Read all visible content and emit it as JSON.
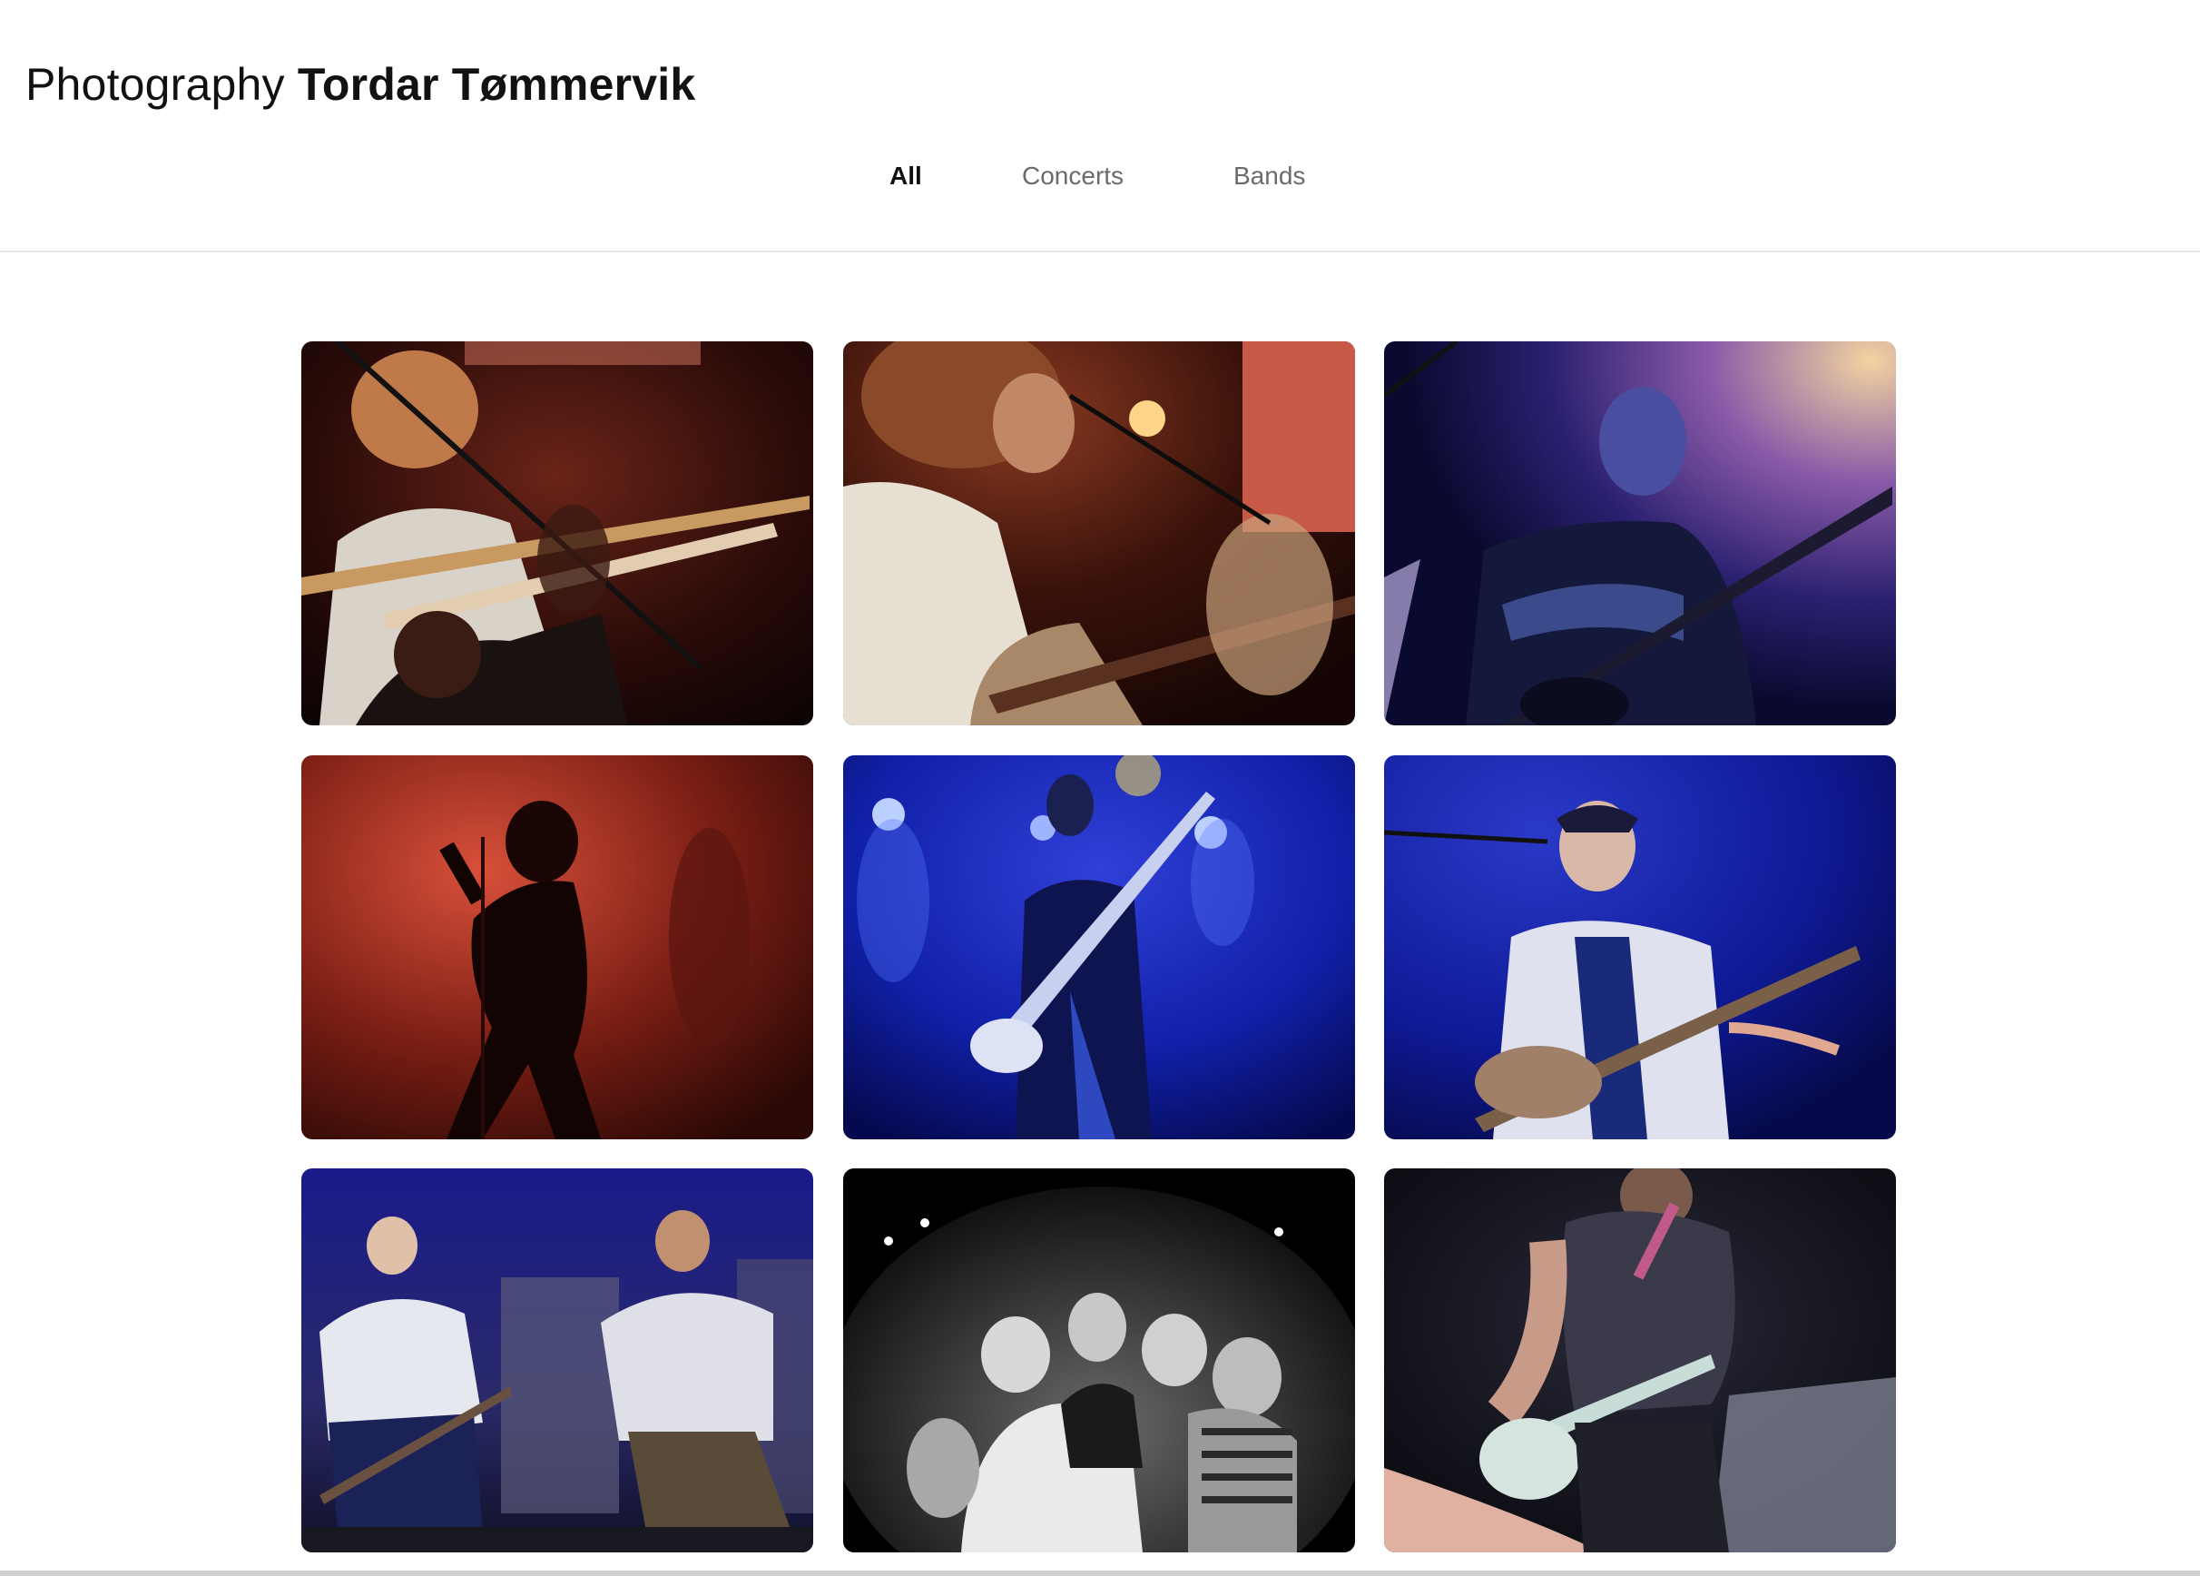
{
  "header": {
    "title_light": "Photography",
    "title_bold": "Tordar Tømmervik"
  },
  "nav": {
    "items": [
      {
        "label": "All",
        "active": true
      },
      {
        "label": "Concerts",
        "active": false
      },
      {
        "label": "Bands",
        "active": false
      }
    ]
  },
  "gallery": {
    "photos": [
      {
        "subject": "guitarist singing with head tilted back, red stage light"
      },
      {
        "subject": "long-haired singer at microphone playing sunburst guitar"
      },
      {
        "subject": "bearded guitarist under blue and purple light"
      },
      {
        "subject": "silhouetted singer at microphone against red light"
      },
      {
        "subject": "bass player under blue stage spotlights"
      },
      {
        "subject": "smiling guitarist in cap with vintage guitar, blue light"
      },
      {
        "subject": "two performers drinking on stage, blue light"
      },
      {
        "subject": "fisheye group portrait of band in black and white"
      },
      {
        "subject": "guitarist kneeling on dark stage with pink strap"
      }
    ]
  }
}
